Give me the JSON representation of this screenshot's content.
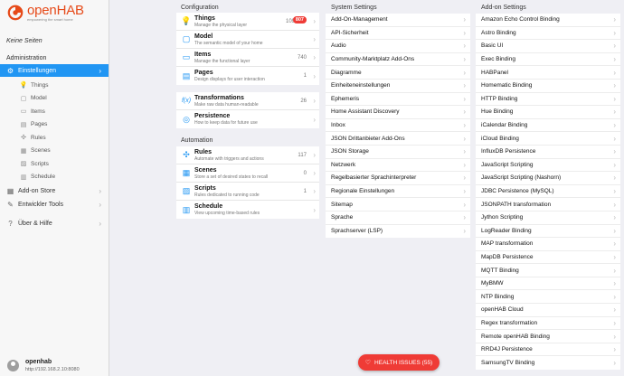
{
  "brand": {
    "name": "openHAB",
    "tagline": "empowering the smart home",
    "color": "#e64a19"
  },
  "sidebar": {
    "no_pages": "Keine Seiten",
    "section": "Administration",
    "settings": {
      "label": "Einstellungen",
      "icon": "gear-icon"
    },
    "sub_items": [
      {
        "label": "Things",
        "icon": "bulb-icon"
      },
      {
        "label": "Model",
        "icon": "model-icon"
      },
      {
        "label": "Items",
        "icon": "items-icon"
      },
      {
        "label": "Pages",
        "icon": "pages-icon"
      },
      {
        "label": "Rules",
        "icon": "rules-icon"
      },
      {
        "label": "Scenes",
        "icon": "scenes-icon"
      },
      {
        "label": "Scripts",
        "icon": "scripts-icon"
      },
      {
        "label": "Schedule",
        "icon": "schedule-icon"
      }
    ],
    "addon_store": "Add-on Store",
    "dev_tools": "Entwickler Tools",
    "help": "Über & Hilfe",
    "user": {
      "name": "openhab",
      "address": "http://192.168.2.10:8080"
    }
  },
  "configuration": {
    "title": "Configuration",
    "rows": [
      {
        "title": "Things",
        "subtitle": "Manage the physical layer",
        "count": "109",
        "badge": "807"
      },
      {
        "title": "Model",
        "subtitle": "The semantic model of your home",
        "count": ""
      },
      {
        "title": "Items",
        "subtitle": "Manage the functional layer",
        "count": "740"
      },
      {
        "title": "Pages",
        "subtitle": "Design displays for user interaction",
        "count": "1"
      }
    ],
    "rows2": [
      {
        "title": "Transformations",
        "subtitle": "Make raw data human-readable",
        "count": "26"
      },
      {
        "title": "Persistence",
        "subtitle": "How to keep data for future use",
        "count": ""
      }
    ]
  },
  "automation": {
    "title": "Automation",
    "rows": [
      {
        "title": "Rules",
        "subtitle": "Automate with triggers and actions",
        "count": "117"
      },
      {
        "title": "Scenes",
        "subtitle": "Store a set of desired states to recall",
        "count": "0"
      },
      {
        "title": "Scripts",
        "subtitle": "Rules dedicated to running code",
        "count": "1"
      },
      {
        "title": "Schedule",
        "subtitle": "View upcoming time-based rules",
        "count": ""
      }
    ]
  },
  "system_settings": {
    "title": "System Settings",
    "items": [
      "Add-On-Management",
      "API-Sicherheit",
      "Audio",
      "Community-Marktplatz Add-Ons",
      "Diagramme",
      "Einheiteneinstellungen",
      "Ephemeris",
      "Home Assistant Discovery",
      "Inbox",
      "JSON Drittanbieter Add-Ons",
      "JSON Storage",
      "Netzwerk",
      "Regelbasierter Sprachinterpreter",
      "Regionale Einstellungen",
      "Sitemap",
      "Sprache",
      "Sprachserver (LSP)"
    ]
  },
  "addon_settings": {
    "title": "Add-on Settings",
    "items": [
      "Amazon Echo Control Binding",
      "Astro Binding",
      "Basic UI",
      "Exec Binding",
      "HABPanel",
      "Homematic Binding",
      "HTTP Binding",
      "Hue Binding",
      "iCalendar Binding",
      "iCloud Binding",
      "InfluxDB Persistence",
      "JavaScript Scripting",
      "JavaScript Scripting (Nashorn)",
      "JDBC Persistence (MySQL)",
      "JSONPATH transformation",
      "Jython Scripting",
      "LogReader Binding",
      "MAP transformation",
      "MapDB Persistence",
      "MQTT Binding",
      "MyBMW",
      "NTP Binding",
      "openHAB Cloud",
      "Regex transformation",
      "Remote openHAB Binding",
      "RRD4J Persistence",
      "SamsungTV Binding"
    ]
  },
  "health": {
    "label": "HEALTH ISSUES (55)",
    "color": "#ef3b36"
  },
  "accent": "#2196f3"
}
